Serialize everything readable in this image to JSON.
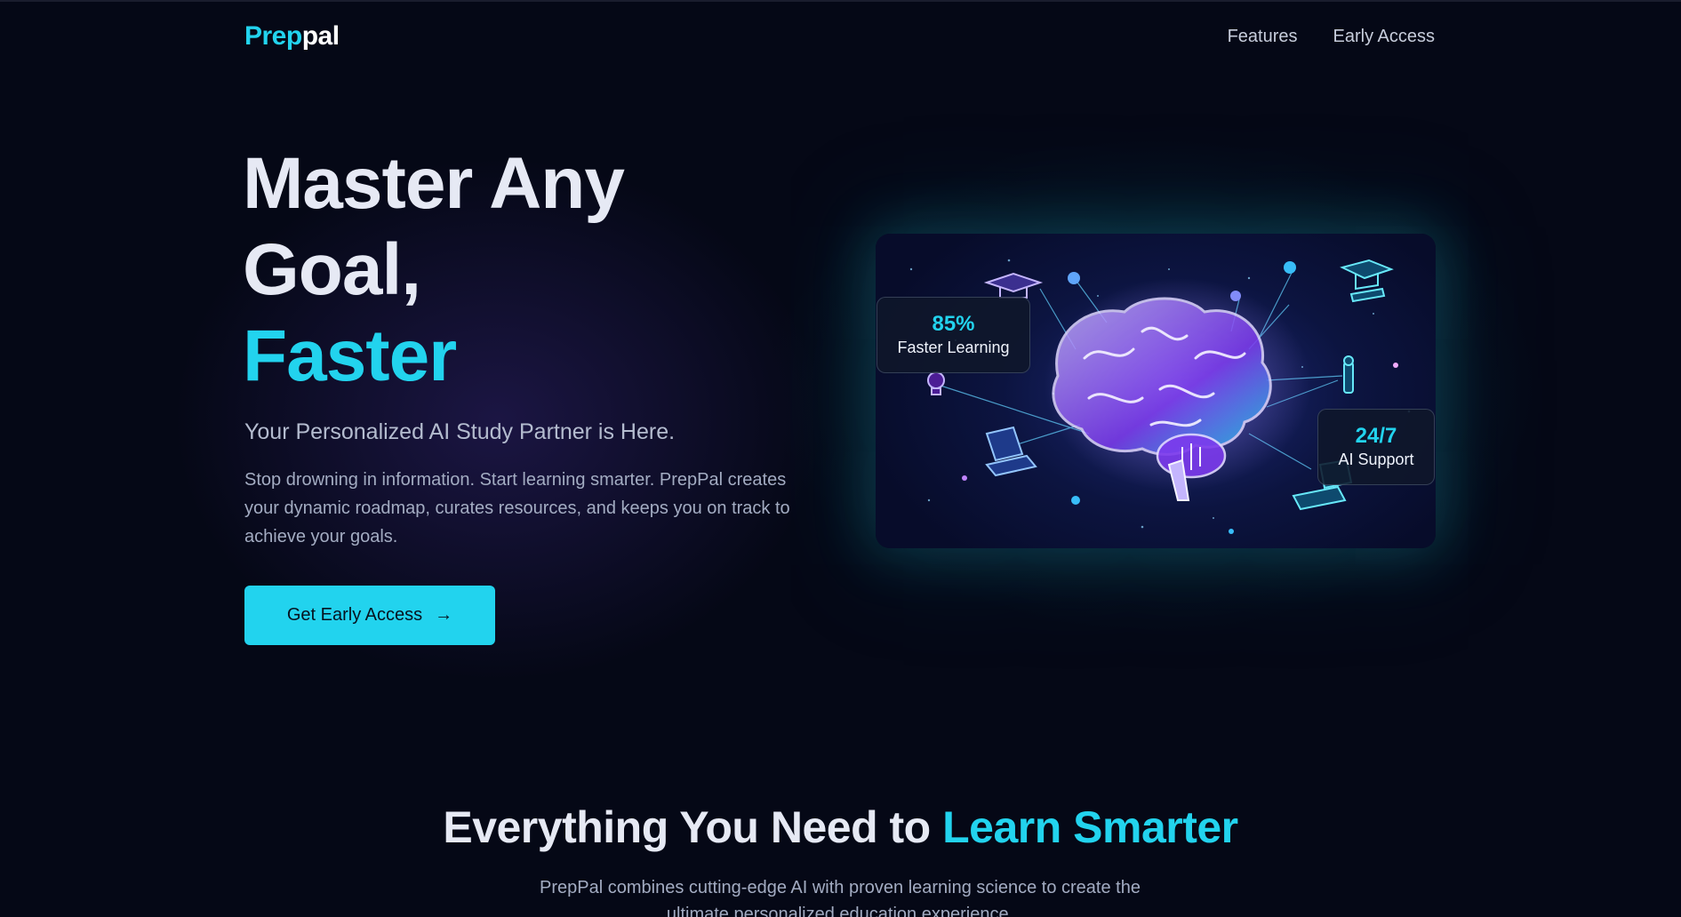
{
  "brand": {
    "logo_part1": "Prep",
    "logo_part2": "pal"
  },
  "nav": {
    "links": [
      "Features",
      "Early Access"
    ]
  },
  "hero": {
    "title_line1": "Master Any",
    "title_line2": "Goal,",
    "title_accent": "Faster",
    "subtitle": "Your Personalized AI Study Partner is Here.",
    "description": "Stop drowning in information. Start learning smarter. PrepPal creates your dynamic roadmap, curates resources, and keeps you on track to achieve your goals.",
    "cta_label": "Get Early Access",
    "cta_icon": "arrow-right-icon"
  },
  "stats": [
    {
      "value": "85%",
      "label": "Faster Learning"
    },
    {
      "value": "24/7",
      "label": "AI Support"
    }
  ],
  "features_section": {
    "title_plain": "Everything You Need to ",
    "title_accent": "Learn Smarter",
    "description": "PrepPal combines cutting-edge AI with proven learning science to create the ultimate personalized education experience."
  },
  "colors": {
    "background": "#050816",
    "accent": "#22d3ee",
    "heading": "#e6e9f4",
    "muted_text": "#a3acc2"
  }
}
